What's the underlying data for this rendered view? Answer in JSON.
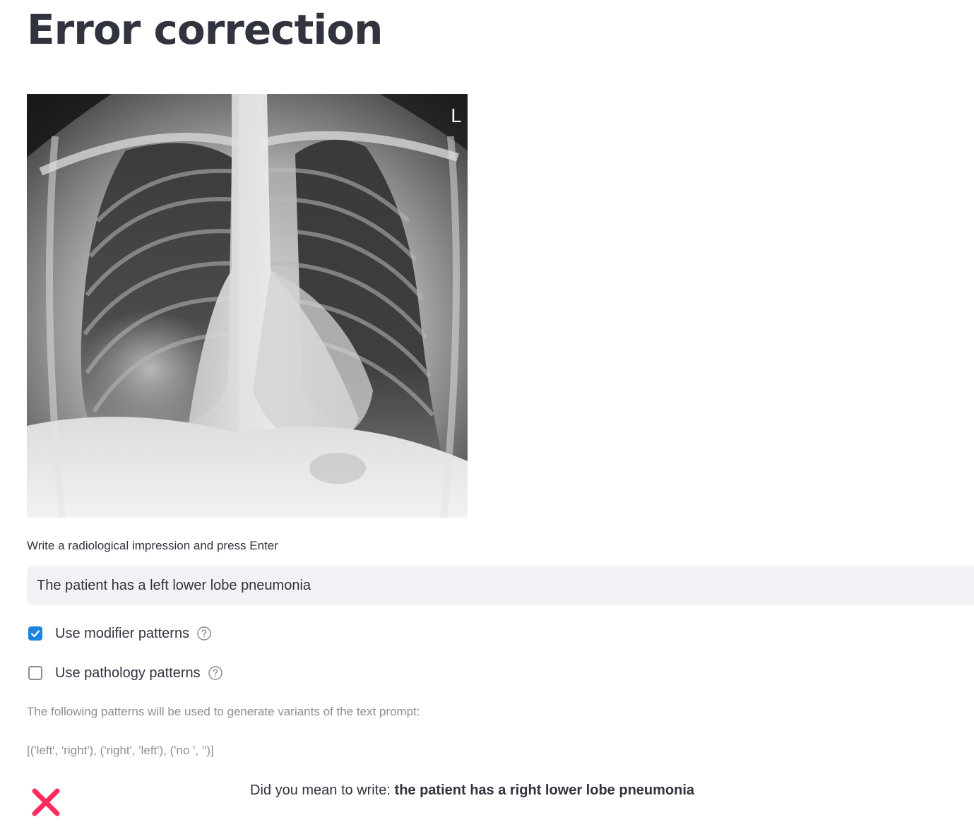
{
  "page": {
    "title": "Error correction"
  },
  "image": {
    "marker": "L"
  },
  "prompt": {
    "label": "Write a radiological impression and press Enter",
    "value": "The patient has a left lower lobe pneumonia"
  },
  "options": [
    {
      "label": "Use modifier patterns",
      "checked": true,
      "icon": "help-circle-icon"
    },
    {
      "label": "Use pathology patterns",
      "checked": false,
      "icon": "help-circle-icon"
    }
  ],
  "patterns": {
    "intro": "The following patterns will be used to generate variants of the text prompt:",
    "list": "[('left', 'right'), ('right', 'left'), ('no ', '')]"
  },
  "result": {
    "status_icon": "cross-icon",
    "status_color": "#ff2b5e",
    "lead": "Did you mean to write: ",
    "suggestion": "the patient has a right lower lobe pneumonia"
  },
  "colors": {
    "accent": "#1c83e1",
    "input_bg": "#f0f2f6",
    "text": "#31333f",
    "muted": "#8c8e95"
  }
}
